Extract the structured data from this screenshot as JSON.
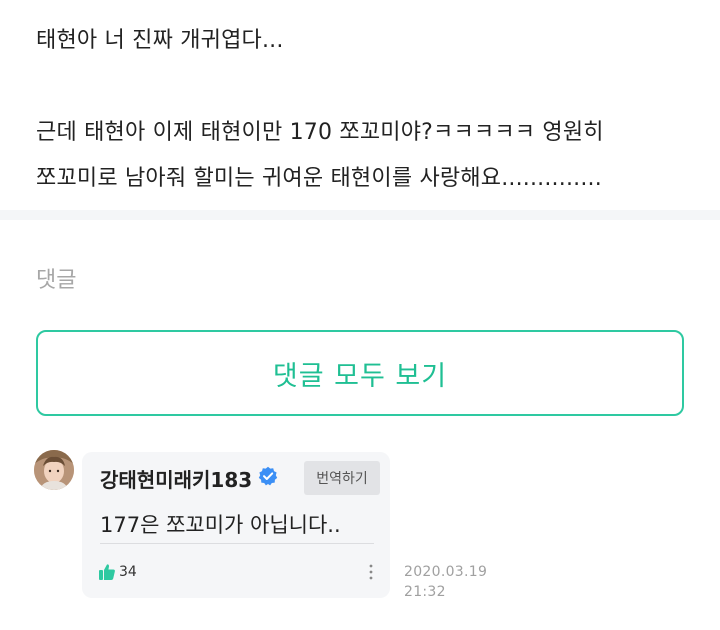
{
  "post": {
    "lines": [
      "태현아 너 진짜 개귀엽다...",
      "",
      "근데 태현아 이제 태현이만 170 쪼꼬미야?ㅋㅋㅋㅋㅋ 영원히",
      "쪼꼬미로 남아줘 할미는 귀여운 태현이를 사랑해요.............."
    ]
  },
  "comments_section": {
    "heading": "댓글",
    "view_all_label": "댓글 모두 보기"
  },
  "comment": {
    "author": "강태현미래키183",
    "verified_icon": "verified-check-icon",
    "translate_label": "번역하기",
    "text": "177은 쪼꼬미가 아닙니다..",
    "likes": "34",
    "date": "2020.03.19",
    "time": "21:32"
  },
  "colors": {
    "accent": "#1fbf93",
    "verified": "#3b8ff5",
    "like": "#2ec9a1"
  }
}
